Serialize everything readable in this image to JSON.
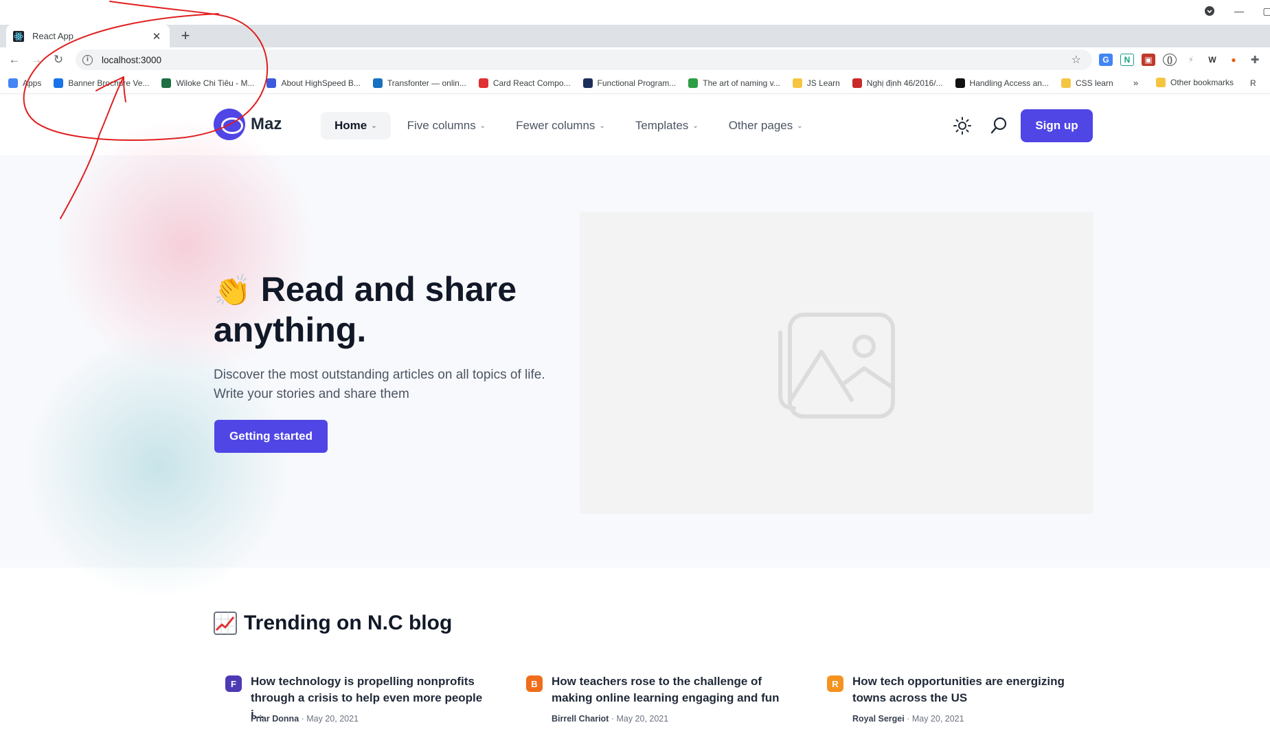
{
  "browser": {
    "tab_title": "React App",
    "url": "localhost:3000",
    "bookmarks": [
      {
        "label": "Apps",
        "icon": "apps-grid-icon",
        "color": "#4285f4"
      },
      {
        "label": "Banner Brochure Ve...",
        "icon": "globe-icon",
        "color": "#1a73e8"
      },
      {
        "label": "Wiloke Chi Tiêu - M...",
        "icon": "excel-icon",
        "color": "#1d6f42"
      },
      {
        "label": "About HighSpeed B...",
        "icon": "cube-icon",
        "color": "#3b5bdb"
      },
      {
        "label": "Transfonter — onlin...",
        "icon": "triangle-icon",
        "color": "#1971c2"
      },
      {
        "label": "Card React Compo...",
        "icon": "codepen-icon",
        "color": "#e03131"
      },
      {
        "label": "Functional Program...",
        "icon": "k-icon",
        "color": "#1c2f5a"
      },
      {
        "label": "The art of naming v...",
        "icon": "green-icon",
        "color": "#2f9e44"
      },
      {
        "label": "JS Learn",
        "icon": "folder-icon",
        "color": "#f5c542"
      },
      {
        "label": "Nghị định 46/2016/...",
        "icon": "seal-icon",
        "color": "#c92a2a"
      },
      {
        "label": "Handling Access an...",
        "icon": "medium-icon",
        "color": "#111111"
      },
      {
        "label": "CSS learn",
        "icon": "folder-icon",
        "color": "#f5c542"
      }
    ],
    "overflow": "»",
    "other_bookmarks": "Other bookmarks",
    "reading_list": "R"
  },
  "site": {
    "logo_text": "Maz",
    "nav": [
      {
        "label": "Home",
        "active": true
      },
      {
        "label": "Five columns",
        "active": false
      },
      {
        "label": "Fewer columns",
        "active": false
      },
      {
        "label": "Templates",
        "active": false
      },
      {
        "label": "Other pages",
        "active": false
      }
    ],
    "signup_label": "Sign up",
    "accent_color": "#4f46e5"
  },
  "hero": {
    "emoji": "👏",
    "title": "Read and share anything.",
    "description_line1": "Discover the most outstanding articles on all topics of life.",
    "description_line2": "Write your stories and share them",
    "cta_label": "Getting started"
  },
  "trending": {
    "emoji_icon": "chart-increasing-icon",
    "title": "Trending on N.C blog",
    "items": [
      {
        "badge": "F",
        "badge_color": "#4c3ab5",
        "title": "How technology is propelling nonprofits through a crisis to help even more people i...",
        "author": "Friar Donna",
        "date": "May 20, 2021"
      },
      {
        "badge": "B",
        "badge_color": "#f06d1a",
        "title": "How teachers rose to the challenge of making online learning engaging and fun",
        "author": "Birrell Chariot",
        "date": "May 20, 2021"
      },
      {
        "badge": "R",
        "badge_color": "#f59320",
        "title": "How tech opportunities are energizing towns across the US",
        "author": "Royal Sergei",
        "date": "May 20, 2021"
      }
    ]
  }
}
